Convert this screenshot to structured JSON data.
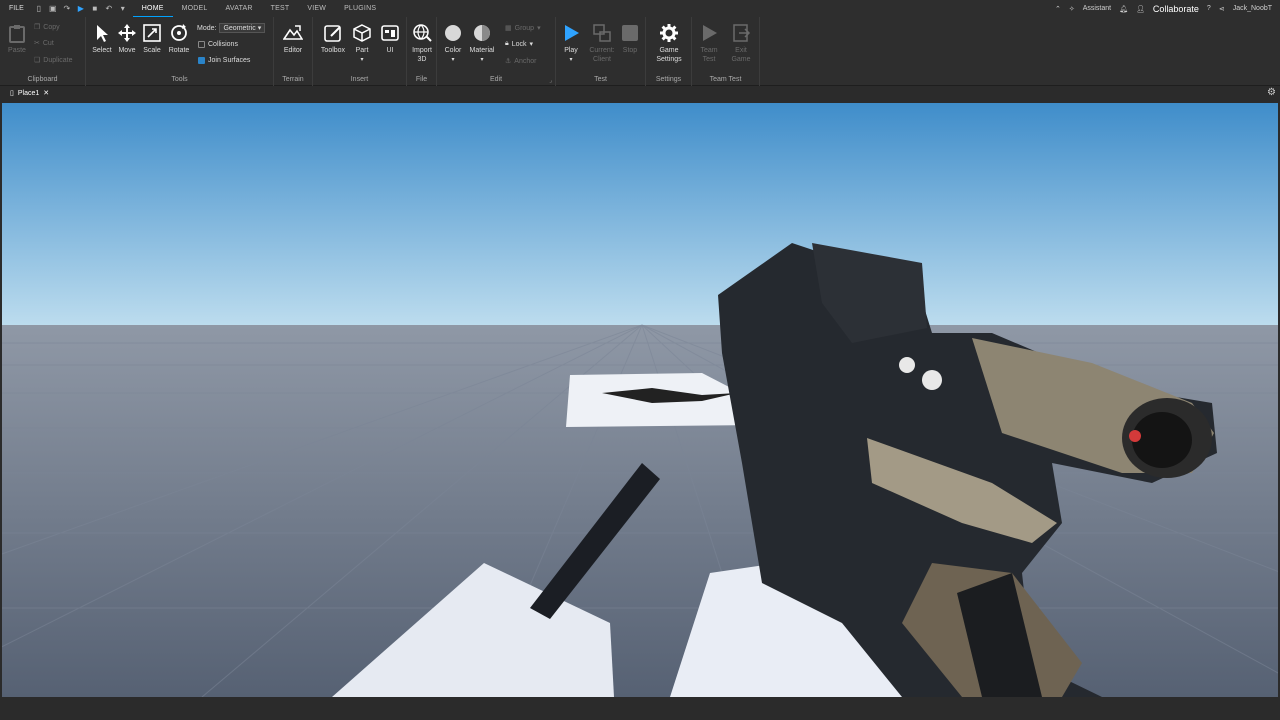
{
  "menubar": {
    "file": "FILE",
    "tabs": [
      "HOME",
      "MODEL",
      "AVATAR",
      "TEST",
      "VIEW",
      "PLUGINS"
    ],
    "active_tab": "HOME",
    "assistant": "Assistant",
    "collaborate": "Collaborate",
    "user": "Jack_NoobT"
  },
  "ribbon": {
    "clipboard": {
      "label": "Clipboard",
      "paste": "Paste",
      "copy": "Copy",
      "cut": "Cut",
      "duplicate": "Duplicate"
    },
    "tools": {
      "label": "Tools",
      "select": "Select",
      "move": "Move",
      "scale": "Scale",
      "rotate": "Rotate",
      "mode_label": "Mode:",
      "mode_value": "Geometric",
      "collisions": "Collisions",
      "join_surfaces": "Join Surfaces"
    },
    "terrain": {
      "label": "Terrain",
      "editor": "Editor"
    },
    "insert": {
      "label": "Insert",
      "toolbox": "Toolbox",
      "part": "Part",
      "ui": "UI"
    },
    "file": {
      "label": "File",
      "import3d_1": "Import",
      "import3d_2": "3D"
    },
    "edit": {
      "label": "Edit",
      "color": "Color",
      "material": "Material",
      "group": "Group",
      "lock": "Lock",
      "anchor": "Anchor"
    },
    "test": {
      "label": "Test",
      "play": "Play",
      "current_client_1": "Current:",
      "current_client_2": "Client",
      "stop": "Stop"
    },
    "settings": {
      "label": "Settings",
      "game_settings_1": "Game",
      "game_settings_2": "Settings"
    },
    "team_test": {
      "label": "Team Test",
      "team_test_1": "Team",
      "team_test_2": "Test",
      "exit_game_1": "Exit",
      "exit_game_2": "Game"
    }
  },
  "document_tab": {
    "name": "Place1"
  },
  "colors": {
    "accent": "#00a2ff",
    "ribbon_bg": "#2e2e2e",
    "sky_top": "#3e8cc8",
    "floor": "#5f6a7c"
  }
}
